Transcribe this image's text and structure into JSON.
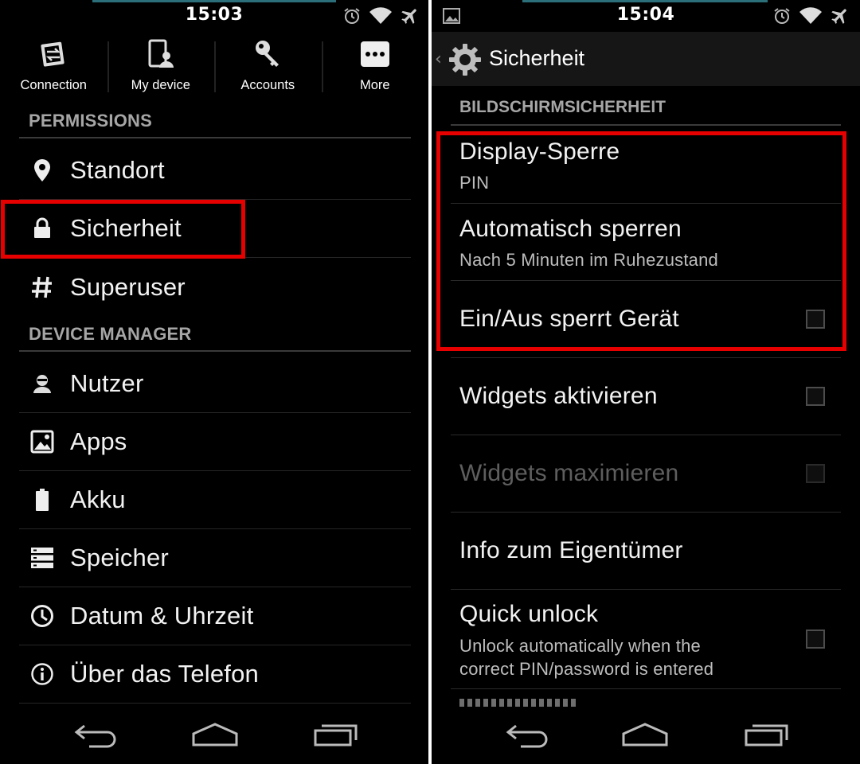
{
  "left_screen": {
    "status": {
      "time": "15:03"
    },
    "tabs": [
      {
        "label": "Connection",
        "icon": "connection-icon"
      },
      {
        "label": "My device",
        "icon": "my-device-icon"
      },
      {
        "label": "Accounts",
        "icon": "accounts-key-icon"
      },
      {
        "label": "More",
        "icon": "more-dots-icon"
      }
    ],
    "sections": [
      {
        "header": "PERMISSIONS",
        "items": [
          {
            "label": "Standort",
            "icon": "location-pin-icon"
          },
          {
            "label": "Sicherheit",
            "icon": "lock-icon",
            "highlighted": true
          },
          {
            "label": "Superuser",
            "icon": "hash-icon"
          }
        ]
      },
      {
        "header": "DEVICE MANAGER",
        "items": [
          {
            "label": "Nutzer",
            "icon": "user-icon"
          },
          {
            "label": "Apps",
            "icon": "apps-icon"
          },
          {
            "label": "Akku",
            "icon": "battery-icon"
          },
          {
            "label": "Speicher",
            "icon": "storage-icon"
          },
          {
            "label": "Datum & Uhrzeit",
            "icon": "clock-icon"
          },
          {
            "label": "Über das Telefon",
            "icon": "info-icon"
          }
        ]
      }
    ]
  },
  "right_screen": {
    "status": {
      "time": "15:04"
    },
    "action_bar": {
      "title": "Sicherheit",
      "icon": "gear-icon"
    },
    "section_header": "BILDSCHIRMSICHERHEIT",
    "prefs": [
      {
        "title": "Display-Sperre",
        "summary": "PIN",
        "checkbox": false,
        "highlighted": true
      },
      {
        "title": "Automatisch sperren",
        "summary": "Nach 5 Minuten im Ruhezustand",
        "checkbox": false,
        "highlighted": true
      },
      {
        "title": "Ein/Aus sperrt Gerät",
        "checkbox": true,
        "checked": false,
        "highlighted": true
      },
      {
        "title": "Widgets aktivieren",
        "checkbox": true,
        "checked": false
      },
      {
        "title": "Widgets maximieren",
        "checkbox": true,
        "checked": false,
        "disabled": true
      },
      {
        "title": "Info zum Eigentümer",
        "checkbox": false
      },
      {
        "title": "Quick unlock",
        "summary": "Unlock automatically when the correct PIN/password is entered",
        "summary_lines": [
          "Unlock automatically when the",
          "correct PIN/password is entered"
        ],
        "checkbox": true,
        "checked": false
      }
    ]
  },
  "colors": {
    "highlight": "#e60000",
    "background": "#000000",
    "section_text": "#a6a6a6",
    "status_indicator": "#2b6f7a"
  }
}
